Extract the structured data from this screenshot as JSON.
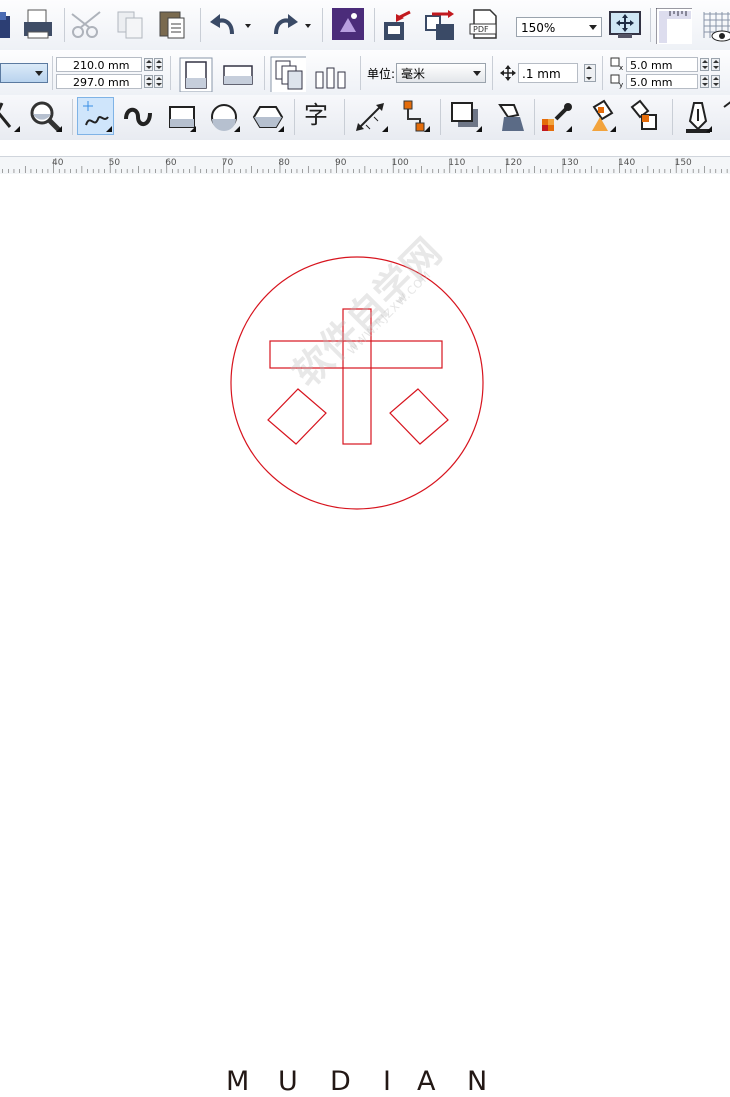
{
  "standard_toolbar": {
    "zoom_value": "150%"
  },
  "property_bar": {
    "width_value": "210.0 mm",
    "height_value": "297.0 mm",
    "units_label": "单位:",
    "units_value": "毫米",
    "nudge_value": ".1 mm",
    "dup_x_value": "5.0 mm",
    "dup_y_value": "5.0 mm"
  },
  "ruler": {
    "ticks": [
      "40",
      "50",
      "60",
      "70",
      "80",
      "90",
      "100",
      "110",
      "120",
      "130",
      "140",
      "150"
    ]
  },
  "toolbox": {
    "text_tool_glyph": "字"
  },
  "canvas": {
    "brand_letters": [
      "M",
      "U",
      "D",
      "I",
      "A",
      "N"
    ],
    "logo_stroke_color": "#d7141e",
    "watermark_text": "软件自学网",
    "watermark_url": "WWW.RJZXW.COM"
  }
}
